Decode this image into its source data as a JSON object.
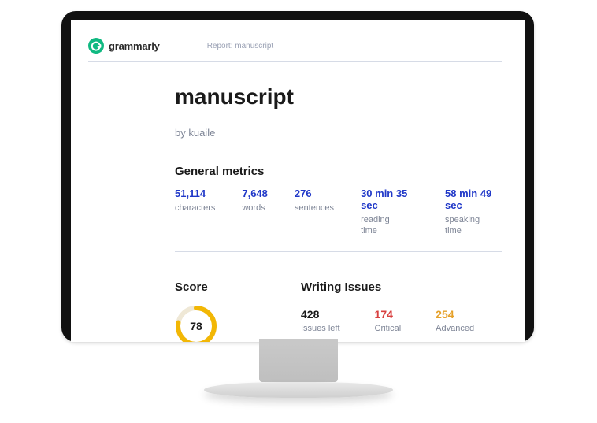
{
  "brand": "grammarly",
  "breadcrumb": "Report: manuscript",
  "title": "manuscript",
  "byline": "by kuaile",
  "sections": {
    "metrics_heading": "General metrics",
    "score_heading": "Score",
    "issues_heading": "Writing Issues"
  },
  "metrics": {
    "characters": {
      "value": "51,114",
      "label": "characters"
    },
    "words": {
      "value": "7,648",
      "label": "words"
    },
    "sentences": {
      "value": "276",
      "label": "sentences"
    },
    "reading": {
      "value": "30 min 35 sec",
      "label_l1": "reading",
      "label_l2": "time"
    },
    "speaking": {
      "value": "58 min 49 sec",
      "label_l1": "speaking",
      "label_l2": "time"
    }
  },
  "score": {
    "value": "78",
    "percent": 78,
    "ring_color": "#f2b705",
    "track_color": "#efe8d6"
  },
  "issues": {
    "left": {
      "value": "428",
      "label": "Issues left"
    },
    "critical": {
      "value": "174",
      "label": "Critical"
    },
    "advanced": {
      "value": "254",
      "label": "Advanced"
    }
  }
}
